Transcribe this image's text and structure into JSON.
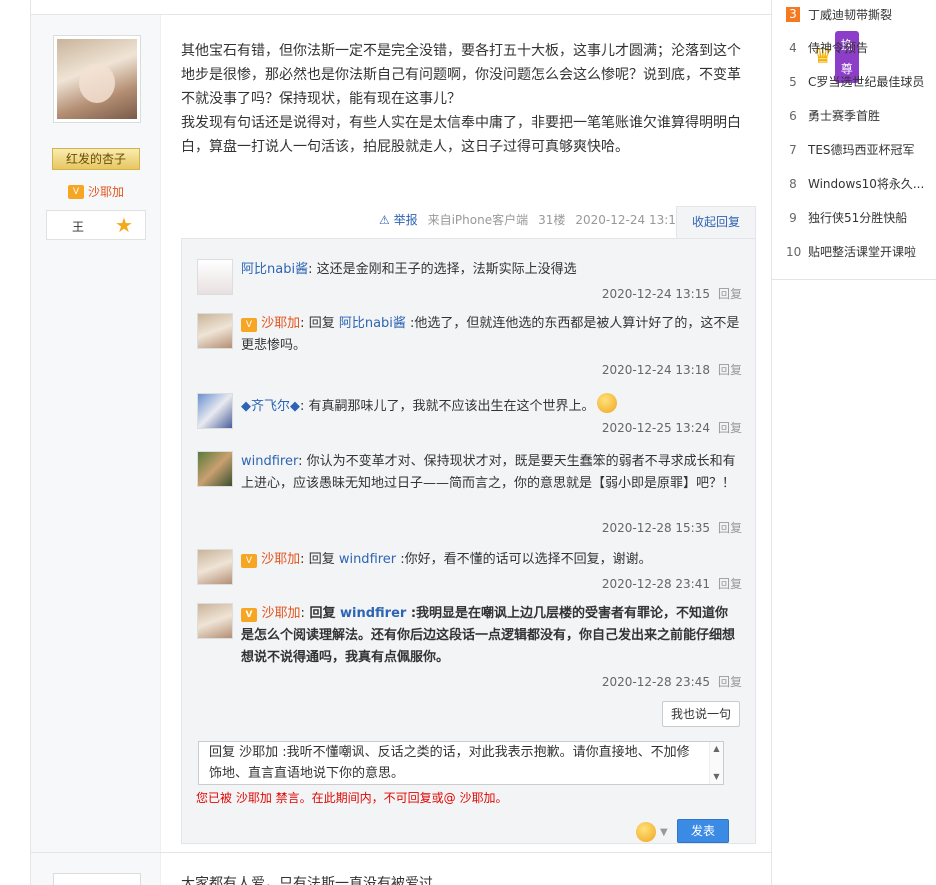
{
  "hot_list": [
    {
      "num": "3",
      "title": "丁威迪韧带撕裂"
    },
    {
      "num": "4",
      "title": "侍神令预告"
    },
    {
      "num": "5",
      "title": "C罗当选世纪最佳球员"
    },
    {
      "num": "6",
      "title": "勇士赛季首胜"
    },
    {
      "num": "7",
      "title": "TES德玛西亚杯冠军"
    },
    {
      "num": "8",
      "title": "Windows10将永久..."
    },
    {
      "num": "9",
      "title": "独行侠51分胜快船"
    },
    {
      "num": "10",
      "title": "贴吧整活课堂开课啦"
    }
  ],
  "post": {
    "username": "红发的杏子",
    "vip_name": "沙耶加",
    "level_label": "王",
    "vip_badge": "挽尊",
    "content_line1": "其他宝石有错，但你法斯一定不是完全没错，要各打五十大板，这事儿才圆满；沦落到这个地步是很惨，那必然也是你法斯自己有问题啊，你没问题怎么会这么惨呢？说到底，不变革不就没事了吗？保持现状，能有现在这事儿？",
    "content_line2": "我发现有句话还是说得对，有些人实在是太信奉中庸了，非要把一笔笔账谁欠谁算得明明白白，算盘一打说人一句活该，拍屁股就走人，这日子过得可真够爽快哈。",
    "report": "举报",
    "client": "来自iPhone客户端",
    "floor": "31楼",
    "time": "2020-12-24 13:13",
    "collapse": "收起回复"
  },
  "replies": [
    {
      "user": "阿比nabi酱",
      "sep": ":",
      "text": "这还是金刚和王子的选择，法斯实际上没得选",
      "time": "2020-12-24 13:15",
      "reply": "回复"
    },
    {
      "user": "沙耶加",
      "sep": ":",
      "prefix": "回复 ",
      "target": "阿比nabi酱",
      "text": " :他选了，但就连他选的东西都是被人算计好了的，这不是更悲惨吗。",
      "time": "2020-12-24 13:18",
      "reply": "回复"
    },
    {
      "user": "◆齐飞尔◆",
      "sep": ":",
      "text": "有真嗣那味儿了，我就不应该出生在这个世界上。",
      "time": "2020-12-25 13:24",
      "reply": "回复"
    },
    {
      "user": "windfirer",
      "sep": ":",
      "text": "你认为不变革才对、保持现状才对，既是要天生蠢笨的弱者不寻求成长和有上进心，应该愚昧无知地过日子——简而言之，你的意思就是【弱小即是原罪】吧？！",
      "time": "2020-12-28 15:35",
      "reply": "回复"
    },
    {
      "user": "沙耶加",
      "sep": ":",
      "prefix": "回复 ",
      "target": "windfirer",
      "text": " :你好，看不懂的话可以选择不回复，谢谢。",
      "time": "2020-12-28 23:41",
      "reply": "回复"
    },
    {
      "user": "沙耶加",
      "sep": ":",
      "prefix": "回复 ",
      "target": "windfirer",
      "text": " :我明显是在嘲讽上边几层楼的受害者有罪论，不知道你是怎么个阅读理解法。还有你后边这段话一点逻辑都没有，你自己发出来之前能仔细想想说不说得通吗，我真有点佩服你。",
      "time": "2020-12-28 23:45",
      "reply": "回复"
    }
  ],
  "say_button": "我也说一句",
  "editor_text": "回复 沙耶加 :我听不懂嘲讽、反话之类的话，对此我表示抱歉。请你直接地、不加修饰地、直言直语地说下你的意思。",
  "ban_notice": "您已被 沙耶加 禁言。在此期间内，不可回复或@ 沙耶加。",
  "send_button": "发表",
  "next_post_text": "大家都有人爱，只有法斯一直没有被爱过"
}
